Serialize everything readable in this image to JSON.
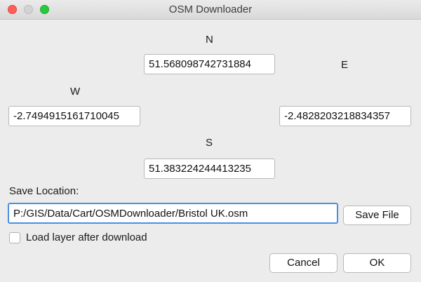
{
  "window": {
    "title": "OSM Downloader"
  },
  "coords": {
    "north_label": "N",
    "north_value": "51.568098742731884",
    "east_label": "E",
    "east_value": "-2.4828203218834357",
    "west_label": "W",
    "west_value": "-2.7494915161710045",
    "south_label": "S",
    "south_value": "51.383224244413235"
  },
  "save": {
    "label": "Save Location:",
    "path": "P:/GIS/Data/Cart/OSMDownloader/Bristol UK.osm",
    "save_file_label": "Save File"
  },
  "options": {
    "load_layer_label": "Load layer after download",
    "load_layer_checked": false
  },
  "footer": {
    "cancel_label": "Cancel",
    "ok_label": "OK"
  }
}
